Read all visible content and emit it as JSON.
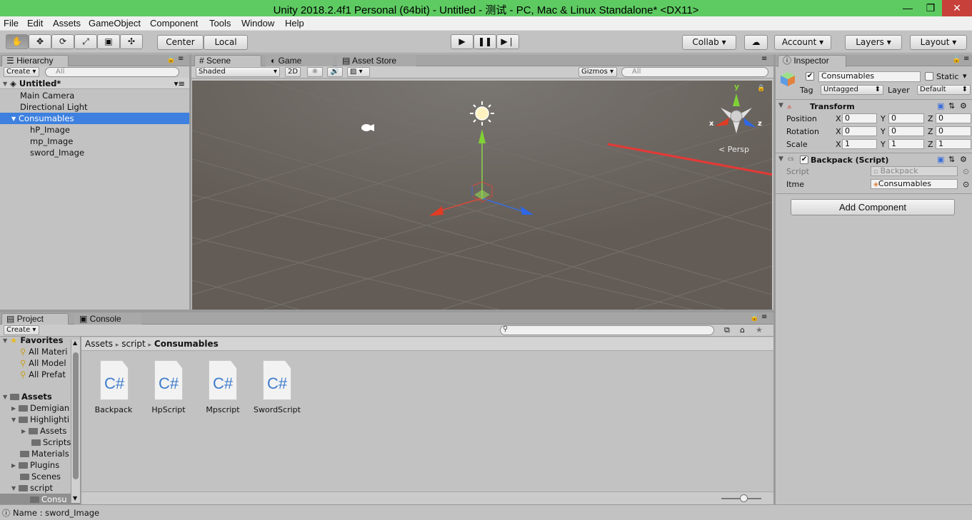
{
  "window": {
    "title": "Unity 2018.2.4f1 Personal (64bit) - Untitled - 测试 - PC, Mac & Linux Standalone* <DX11>"
  },
  "menu": [
    "File",
    "Edit",
    "Assets",
    "GameObject",
    "Component",
    "Tools",
    "Window",
    "Help"
  ],
  "toolbar": {
    "pivot": "Center",
    "space": "Local",
    "collab": "Collab",
    "account": "Account",
    "layers": "Layers",
    "layout": "Layout"
  },
  "hierarchy": {
    "tab": "Hierarchy",
    "create": "Create",
    "search_placeholder": "All",
    "scene": "Untitled*",
    "items": [
      "Main Camera",
      "Directional Light",
      "Consumables",
      "hP_Image",
      "mp_Image",
      "sword_Image"
    ]
  },
  "scene_view": {
    "tabs": [
      "Scene",
      "Game",
      "Asset Store"
    ],
    "shading": "Shaded",
    "mode_2d": "2D",
    "gizmos": "Gizmos",
    "search_placeholder": "All",
    "persp": "Persp",
    "axis": {
      "x": "x",
      "y": "y",
      "z": "z"
    }
  },
  "inspector": {
    "tab": "Inspector",
    "object_name": "Consumables",
    "static": "Static",
    "tag_label": "Tag",
    "tag": "Untagged",
    "layer_label": "Layer",
    "layer": "Default",
    "transform": {
      "title": "Transform",
      "rows": [
        {
          "label": "Position",
          "x": "0",
          "y": "0",
          "z": "0"
        },
        {
          "label": "Rotation",
          "x": "0",
          "y": "0",
          "z": "0"
        },
        {
          "label": "Scale",
          "x": "1",
          "y": "1",
          "z": "1"
        }
      ],
      "axis_x": "X",
      "axis_y": "Y",
      "axis_z": "Z"
    },
    "backpack": {
      "title": "Backpack (Script)",
      "script_label": "Script",
      "script_value": "Backpack",
      "itme_label": "Itme",
      "itme_value": "Consumables"
    },
    "add_component": "Add Component"
  },
  "project": {
    "tabs": [
      "Project",
      "Console"
    ],
    "create": "Create",
    "favorites": {
      "title": "Favorites",
      "items": [
        "All Materi",
        "All Model",
        "All Prefat"
      ]
    },
    "assets": {
      "title": "Assets",
      "items": [
        "Demigian",
        "Highlighti",
        "Assets",
        "Scripts",
        "Materials",
        "Plugins",
        "Scenes",
        "script",
        "Consu"
      ]
    },
    "breadcrumb": [
      "Assets",
      "script",
      "Consumables"
    ],
    "files": [
      "Backpack",
      "HpScript",
      "Mpscript",
      "SwordScript"
    ],
    "file_icon_text": "C#"
  },
  "status": {
    "text": "Name : sword_Image"
  },
  "colors": {
    "titlebar": "#5ecb62",
    "selection": "#3d80df",
    "scene_bg": "#645d57",
    "arrow": "#e53935"
  }
}
